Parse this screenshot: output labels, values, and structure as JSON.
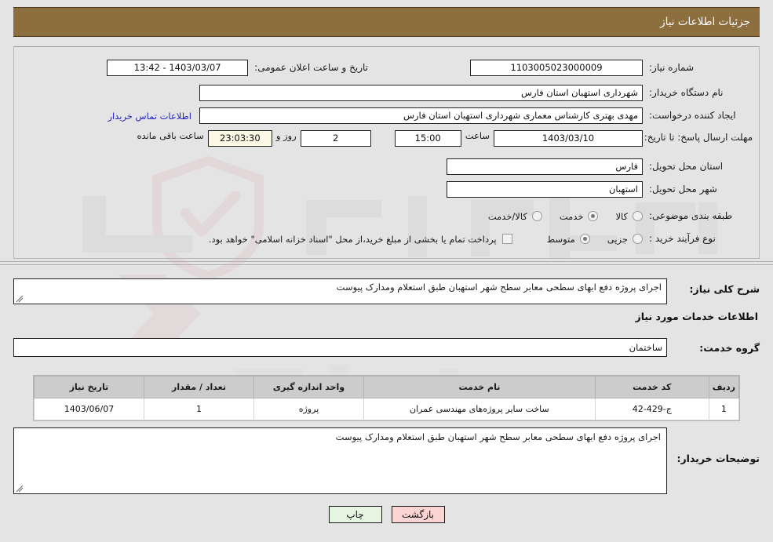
{
  "header": {
    "title": "جزئیات اطلاعات نیاز"
  },
  "colors": {
    "header_bar": "#8d6e3f",
    "link": "#2222cc",
    "note_red": "#c62020",
    "btn_print_bg": "#e6f5e1",
    "btn_back_bg": "#fbd4d4",
    "countdown_bg": "#fbf8e3",
    "table_header_bg": "#cccccc",
    "page_bg": "#e4e4e4"
  },
  "form": {
    "need_number": {
      "label": "شماره نیاز:",
      "value": "1103005023000009"
    },
    "announce_datetime": {
      "label": "تاریخ و ساعت اعلان عمومی:",
      "value": "1403/03/07 - 13:42"
    },
    "buyer_org": {
      "label": "نام دستگاه خریدار:",
      "value": "شهرداری استهبان استان فارس"
    },
    "request_creator": {
      "label": "ایجاد کننده درخواست:",
      "value": "مهدی بهتری کارشناس معماری شهرداری استهبان استان فارس"
    },
    "buyer_contact_link": "اطلاعات تماس خریدار",
    "deadline": {
      "label": "مهلت ارسال پاسخ: تا تاریخ:",
      "date": "1403/03/10",
      "time_label": "ساعت",
      "time": "15:00",
      "days": "2",
      "days_label": "روز و",
      "countdown": "23:03:30",
      "countdown_label": "ساعت باقی مانده"
    },
    "delivery_province": {
      "label": "استان محل تحویل:",
      "value": "فارس"
    },
    "delivery_city": {
      "label": "شهر محل تحویل:",
      "value": "استهبان"
    },
    "subject_category": {
      "label": "طبقه بندی موضوعی:",
      "options": [
        "کالا",
        "خدمت",
        "کالا/خدمت"
      ],
      "selected": "خدمت"
    },
    "purchase_process": {
      "label": "نوع فرآیند خرید :",
      "options": [
        "جزیی",
        "متوسط"
      ],
      "selected": "متوسط"
    },
    "treasury_note": {
      "checked": false,
      "text": "پرداخت تمام یا بخشی از مبلغ خرید،از محل \"اسناد خزانه اسلامی\" خواهد بود."
    },
    "general_description": {
      "label": "شرح کلی نیاز:",
      "value": "اجرای پروژه دفع ابهای سطحی معابر سطح شهر استهبان طبق استعلام ومدارک پیوست"
    },
    "services_heading": "اطلاعات خدمات مورد نیاز",
    "service_group": {
      "label": "گروه خدمت:",
      "value": "ساختمان"
    },
    "buyer_notes": {
      "label": "توضیحات خریدار:",
      "value": "اجرای پروژه دفع ابهای سطحی معابر سطح شهر استهبان طبق استعلام ومدارک پیوست"
    }
  },
  "table": {
    "columns": [
      "ردیف",
      "کد خدمت",
      "نام خدمت",
      "واحد اندازه گیری",
      "تعداد / مقدار",
      "تاریخ نیاز"
    ],
    "rows": [
      {
        "radif": "1",
        "code": "ج-429-42",
        "name": "ساخت سایر پروژه‌های مهندسی عمران",
        "unit": "پروژه",
        "quantity": "1",
        "need_date": "1403/06/07"
      }
    ]
  },
  "buttons": {
    "print": "چاپ",
    "back": "بازگشت"
  }
}
